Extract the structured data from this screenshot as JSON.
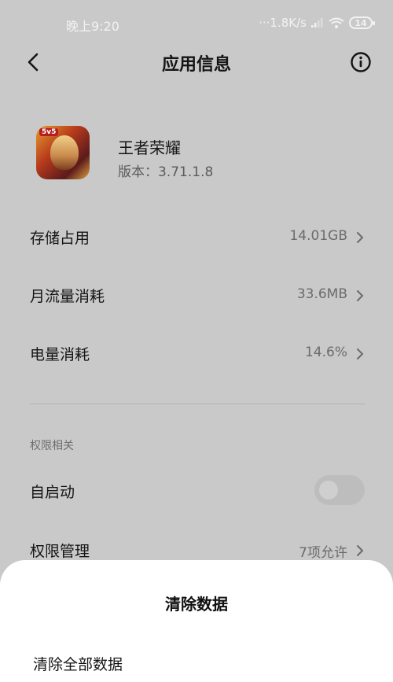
{
  "status_bar": {
    "time": "晚上9:20",
    "network_speed": "···1.8K/s",
    "battery": "14"
  },
  "nav": {
    "title": "应用信息",
    "back_icon": "back-arrow-icon",
    "info_icon": "info-circle-icon"
  },
  "app": {
    "name": "王者荣耀",
    "version": "版本：3.71.1.8",
    "icon_badge": "5v5"
  },
  "rows": [
    {
      "label": "存储占用",
      "value": "14.01GB"
    },
    {
      "label": "月流量消耗",
      "value": "33.6MB"
    },
    {
      "label": "电量消耗",
      "value": "14.6%"
    }
  ],
  "permissions": {
    "section_title": "权限相关",
    "autostart_label": "自启动",
    "autostart_enabled": false,
    "manage_label": "权限管理",
    "manage_value": "7项允许"
  },
  "sheet": {
    "title": "清除数据",
    "option_clear_all": "清除全部数据"
  },
  "colors": {
    "dimmed_background": "#c9c9c9",
    "sheet_background": "#ffffff",
    "primary_text": "#151515",
    "secondary_text": "#6b6b6b"
  }
}
